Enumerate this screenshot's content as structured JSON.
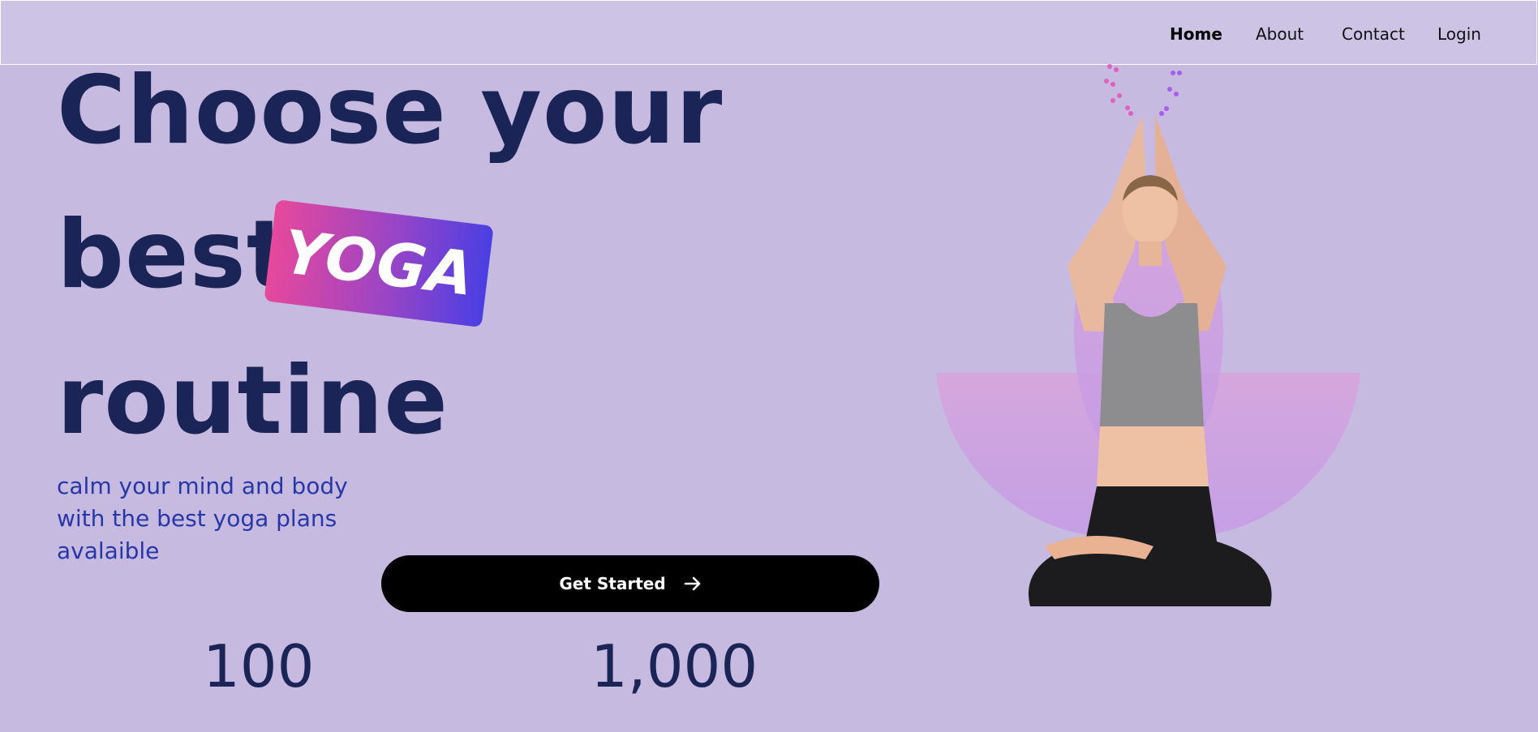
{
  "nav": {
    "items": [
      {
        "label": "Home",
        "active": true
      },
      {
        "label": "About",
        "active": false
      },
      {
        "label": "Contact",
        "active": false
      },
      {
        "label": "Login",
        "active": false
      }
    ]
  },
  "hero": {
    "line1": "Choose your",
    "line2": "best",
    "tag": "YOGA",
    "line3": "routine",
    "subtitle": "calm your mind and body with the best yoga plans avalaible",
    "cta_label": "Get Started",
    "cta_icon": "arrow-right-icon"
  },
  "stats": [
    {
      "value": "100"
    },
    {
      "value": "1,000"
    }
  ],
  "colors": {
    "background": "#c7bae0",
    "navbar": "#cdc3e5",
    "heading": "#1b2456",
    "subtitle": "#2737a7",
    "tag_gradient_start": "#e7489b",
    "tag_gradient_end": "#4a3fe3",
    "cta_background": "#000000",
    "lotus": "#d8a3dc"
  }
}
